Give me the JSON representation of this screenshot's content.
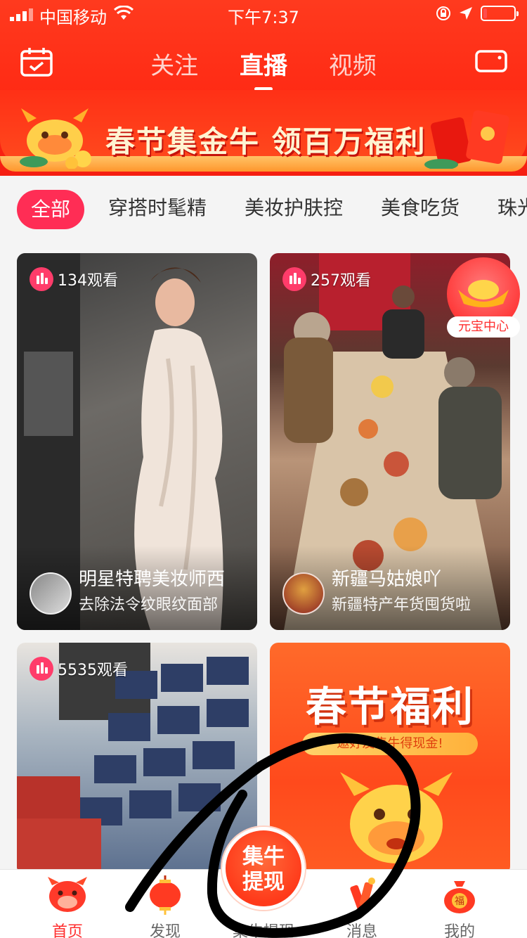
{
  "status_bar": {
    "carrier": "中国移动",
    "time": "下午7:37",
    "battery_level": 0.12
  },
  "top_tabs": [
    {
      "label": "关注",
      "active": false
    },
    {
      "label": "直播",
      "active": true
    },
    {
      "label": "视频",
      "active": false
    }
  ],
  "banner": {
    "text": "春节集金牛 领百万福利"
  },
  "categories": [
    {
      "label": "全部",
      "active": true
    },
    {
      "label": "穿搭时髦精"
    },
    {
      "label": "美妆护肤控"
    },
    {
      "label": "美食吃货"
    },
    {
      "label": "珠光"
    }
  ],
  "cards": [
    {
      "viewers": "134观看",
      "title": "明星特聘美妆师西",
      "subtitle": "去除法令纹眼纹面部"
    },
    {
      "viewers": "257观看",
      "title": "新疆马姑娘吖",
      "subtitle": "新疆特产年货囤货啦"
    },
    {
      "viewers": "5535观看"
    }
  ],
  "floating_badge": {
    "label": "元宝中心"
  },
  "promo": {
    "title": "春节福利",
    "subtitle": "邀好友集牛得现金!"
  },
  "center_button": {
    "line1": "集牛",
    "line2": "提现"
  },
  "tab_bar": [
    {
      "label": "首页",
      "icon": "ox-face-icon",
      "active": true
    },
    {
      "label": "发现",
      "icon": "lantern-icon"
    },
    {
      "label": "集牛提现",
      "icon": "ox-coin-icon"
    },
    {
      "label": "消息",
      "icon": "firecracker-icon"
    },
    {
      "label": "我的",
      "icon": "fortune-bag-icon"
    }
  ],
  "colors": {
    "brand_red": "#ff2a14",
    "accent_pink": "#ff2d55"
  }
}
